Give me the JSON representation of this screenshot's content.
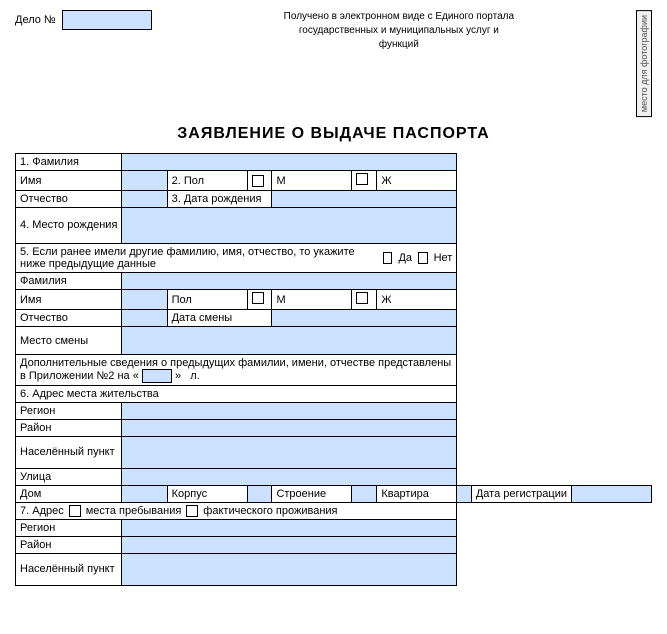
{
  "delo": {
    "label": "Дело №",
    "portal_text": "Получено в электронном виде с Единого портала государственных и муниципальных услуг и функций",
    "photo_label": "место для фотографии"
  },
  "title": "ЗАЯВЛЕНИЕ О ВЫДАЧЕ ПАСПОРТА",
  "fields": {
    "familiya_label": "1. Фамилия",
    "imya_label": "Имя",
    "pol_label": "2. Пол",
    "m_label": "М",
    "zh_label": "Ж",
    "otchestvo_label": "Отчество",
    "data_rozh_label": "3. Дата рождения",
    "mesto_rozh_label": "4. Место рождения",
    "previous_label": "5. Если ранее имели другие фамилию, имя, отчество, то укажите ниже предыдущие данные",
    "da_label": "Да",
    "net_label": "Нет",
    "prev_familiya_label": "Фамилия",
    "prev_imya_label": "Имя",
    "prev_pol_label": "Пол",
    "prev_m_label": "М",
    "prev_zh_label": "Ж",
    "prev_otchestvo_label": "Отчество",
    "prev_data_smeny_label": "Дата смены",
    "prev_mesto_smeny_label": "Место смены",
    "dop_sved": "Дополнительные сведения о предыдущих фамилии, имени, отчестве представлены в Приложении №2 на «",
    "dop_sved_mid": "»",
    "dop_sved_end": "л.",
    "adres_label": "6. Адрес места жительства",
    "region_label": "Регион",
    "rayon_label": "Район",
    "nas_punkt_label": "Населённый пункт",
    "ulitsa_label": "Улица",
    "dom_label": "Дом",
    "korpus_label": "Корпус",
    "stroenie_label": "Строение",
    "kvartira_label": "Квартира",
    "data_reg_label": "Дата регистрации",
    "adres7_label": "7. Адрес",
    "mest_prebyv_label": "места пребывания",
    "fakt_proj_label": "фактического проживания",
    "region2_label": "Регион",
    "rayon2_label": "Район",
    "nas_punkt2_label": "Населённый пункт"
  }
}
